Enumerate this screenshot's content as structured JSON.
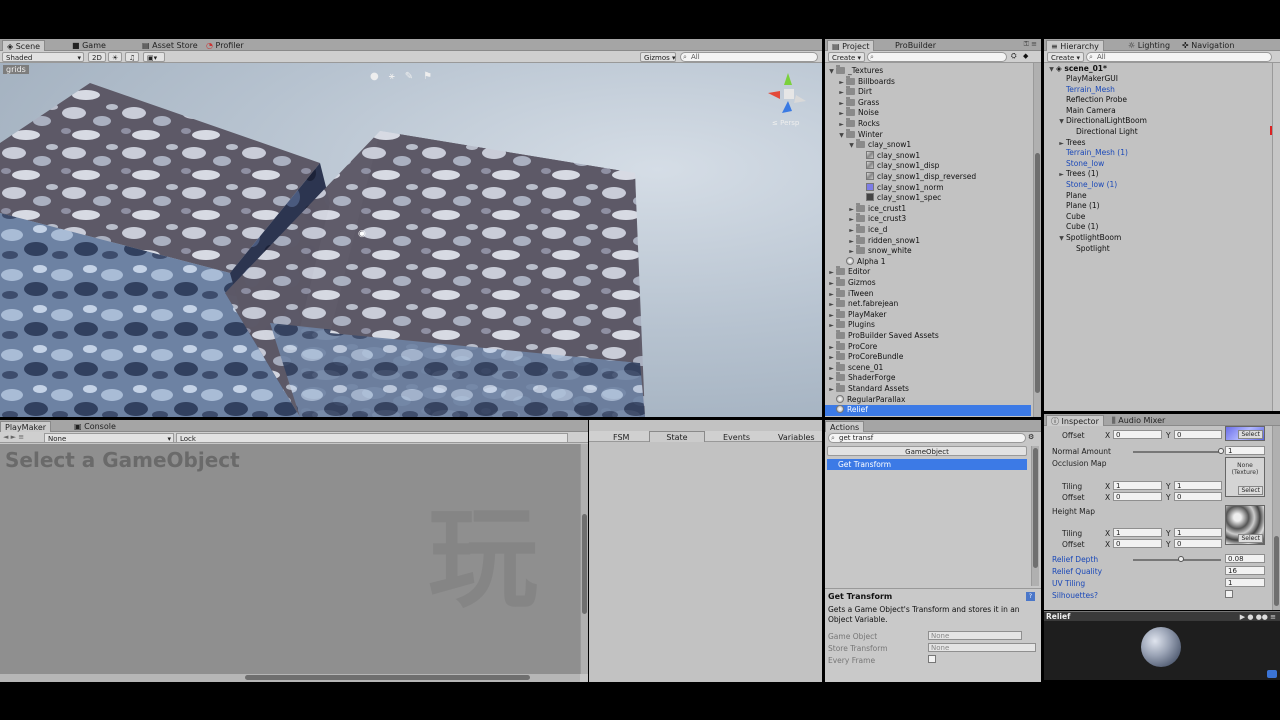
{
  "scene_tabs": [
    "Scene",
    "Game",
    "Asset Store",
    "Profiler"
  ],
  "scene_toolbar": {
    "shading": "Shaded",
    "mode2d": "2D",
    "gizmos": "Gizmos",
    "search_placeholder": "All"
  },
  "scene_overlay": {
    "grids_label": "grids",
    "persp_label": "Persp"
  },
  "project": {
    "tabs": [
      "Project",
      "ProBuilder"
    ],
    "create_label": "Create",
    "items": [
      {
        "label": "_Textures",
        "indent": 0,
        "arrow": "▼",
        "kind": "folder"
      },
      {
        "label": "Billboards",
        "indent": 1,
        "arrow": "►",
        "kind": "folder"
      },
      {
        "label": "Dirt",
        "indent": 1,
        "arrow": "►",
        "kind": "folder"
      },
      {
        "label": "Grass",
        "indent": 1,
        "arrow": "►",
        "kind": "folder"
      },
      {
        "label": "Noise",
        "indent": 1,
        "arrow": "►",
        "kind": "folder"
      },
      {
        "label": "Rocks",
        "indent": 1,
        "arrow": "►",
        "kind": "folder"
      },
      {
        "label": "Winter",
        "indent": 1,
        "arrow": "▼",
        "kind": "folder"
      },
      {
        "label": "clay_snow1",
        "indent": 2,
        "arrow": "▼",
        "kind": "folder"
      },
      {
        "label": "clay_snow1",
        "indent": 3,
        "arrow": "",
        "kind": "tex"
      },
      {
        "label": "clay_snow1_disp",
        "indent": 3,
        "arrow": "",
        "kind": "tex"
      },
      {
        "label": "clay_snow1_disp_reversed",
        "indent": 3,
        "arrow": "",
        "kind": "tex"
      },
      {
        "label": "clay_snow1_norm",
        "indent": 3,
        "arrow": "",
        "kind": "texn"
      },
      {
        "label": "clay_snow1_spec",
        "indent": 3,
        "arrow": "",
        "kind": "texd"
      },
      {
        "label": "ice_crust1",
        "indent": 2,
        "arrow": "►",
        "kind": "folder"
      },
      {
        "label": "ice_crust3",
        "indent": 2,
        "arrow": "►",
        "kind": "folder"
      },
      {
        "label": "ice_d",
        "indent": 2,
        "arrow": "►",
        "kind": "folder"
      },
      {
        "label": "ridden_snow1",
        "indent": 2,
        "arrow": "►",
        "kind": "folder"
      },
      {
        "label": "snow_white",
        "indent": 2,
        "arrow": "►",
        "kind": "folder"
      },
      {
        "label": "Alpha 1",
        "indent": 1,
        "arrow": "",
        "kind": "dot"
      },
      {
        "label": "Editor",
        "indent": 0,
        "arrow": "►",
        "kind": "folder"
      },
      {
        "label": "Gizmos",
        "indent": 0,
        "arrow": "►",
        "kind": "folder"
      },
      {
        "label": "iTween",
        "indent": 0,
        "arrow": "►",
        "kind": "folder"
      },
      {
        "label": "net.fabrejean",
        "indent": 0,
        "arrow": "►",
        "kind": "folder"
      },
      {
        "label": "PlayMaker",
        "indent": 0,
        "arrow": "►",
        "kind": "folder"
      },
      {
        "label": "Plugins",
        "indent": 0,
        "arrow": "►",
        "kind": "folder"
      },
      {
        "label": "ProBuilder Saved Assets",
        "indent": 0,
        "arrow": "",
        "kind": "folder"
      },
      {
        "label": "ProCore",
        "indent": 0,
        "arrow": "►",
        "kind": "folder"
      },
      {
        "label": "ProCoreBundle",
        "indent": 0,
        "arrow": "►",
        "kind": "folder"
      },
      {
        "label": "scene_01",
        "indent": 0,
        "arrow": "►",
        "kind": "folder"
      },
      {
        "label": "ShaderForge",
        "indent": 0,
        "arrow": "►",
        "kind": "folder"
      },
      {
        "label": "Standard Assets",
        "indent": 0,
        "arrow": "►",
        "kind": "folder"
      },
      {
        "label": "RegularParallax",
        "indent": 0,
        "arrow": "",
        "kind": "dot"
      },
      {
        "label": "Relief",
        "indent": 0,
        "arrow": "",
        "kind": "dot",
        "selected": true
      }
    ]
  },
  "hierarchy": {
    "tabs": [
      "Hierarchy",
      "Lighting",
      "Navigation"
    ],
    "create_label": "Create",
    "search_placeholder": "All",
    "scene_name": "scene_01*",
    "items": [
      {
        "label": "PlayMakerGUI",
        "indent": 1,
        "arrow": "",
        "blue": false
      },
      {
        "label": "Terrain_Mesh",
        "indent": 1,
        "arrow": "",
        "blue": true
      },
      {
        "label": "Reflection Probe",
        "indent": 1,
        "arrow": "",
        "blue": false
      },
      {
        "label": "Main Camera",
        "indent": 1,
        "arrow": "",
        "blue": false
      },
      {
        "label": "DirectionalLightBoom",
        "indent": 1,
        "arrow": "▼",
        "blue": false
      },
      {
        "label": "Directional Light",
        "indent": 2,
        "arrow": "",
        "blue": false
      },
      {
        "label": "Trees",
        "indent": 1,
        "arrow": "►",
        "blue": false
      },
      {
        "label": "Terrain_Mesh (1)",
        "indent": 1,
        "arrow": "",
        "blue": true
      },
      {
        "label": "Stone_low",
        "indent": 1,
        "arrow": "",
        "blue": true
      },
      {
        "label": "Trees (1)",
        "indent": 1,
        "arrow": "►",
        "blue": false
      },
      {
        "label": "Stone_low (1)",
        "indent": 1,
        "arrow": "",
        "blue": true
      },
      {
        "label": "Plane",
        "indent": 1,
        "arrow": "",
        "blue": false
      },
      {
        "label": "Plane (1)",
        "indent": 1,
        "arrow": "",
        "blue": false
      },
      {
        "label": "Cube",
        "indent": 1,
        "arrow": "",
        "blue": false
      },
      {
        "label": "Cube (1)",
        "indent": 1,
        "arrow": "",
        "blue": false
      },
      {
        "label": "SpotlightBoom",
        "indent": 1,
        "arrow": "▼",
        "blue": false
      },
      {
        "label": "Spotlight",
        "indent": 2,
        "arrow": "",
        "blue": false
      }
    ]
  },
  "playmaker": {
    "tabs": [
      "PlayMaker",
      "Console"
    ],
    "fsm_select": "None",
    "lock_label": "Lock",
    "placeholder": "Select a GameObject",
    "watermark": "玩",
    "side_tabs": [
      "FSM",
      "State",
      "Events",
      "Variables"
    ]
  },
  "actions": {
    "tab": "Actions",
    "search_value": "get transf",
    "category": "GameObject",
    "selected_action": "Get Transform",
    "detail_title": "Get Transform",
    "detail_desc": "Gets a Game Object's Transform and stores it in an Object Variable.",
    "params": [
      {
        "label": "Game Object",
        "value": "None"
      },
      {
        "label": "Store Transform",
        "value": "None"
      },
      {
        "label": "Every Frame",
        "value": ""
      }
    ]
  },
  "inspector": {
    "tabs": [
      "Inspector",
      "Audio Mixer"
    ],
    "tiling_label": "Tiling",
    "offset_label": "Offset",
    "x_label": "X",
    "y_label": "Y",
    "normal_amount_label": "Normal Amount",
    "normal_amount_value": "1",
    "normal_amount_level": 1.0,
    "occlusion_label": "Occlusion Map",
    "occlusion_none": "None (Texture)",
    "height_label": "Height Map",
    "select_label": "Select",
    "relief_depth_label": "Relief Depth",
    "relief_depth_value": "0.08",
    "relief_depth_level": 0.55,
    "relief_quality_label": "Relief Quality",
    "relief_quality_value": "16",
    "uv_tiling_label": "UV Tiling",
    "uv_tiling_value": "1",
    "silhouettes_label": "Silhouettes?",
    "one": "1",
    "zero": "0",
    "preview_title": "Relief"
  },
  "colors": {
    "selection": "#3c7ae6",
    "header_blue": "#1b49b8"
  }
}
